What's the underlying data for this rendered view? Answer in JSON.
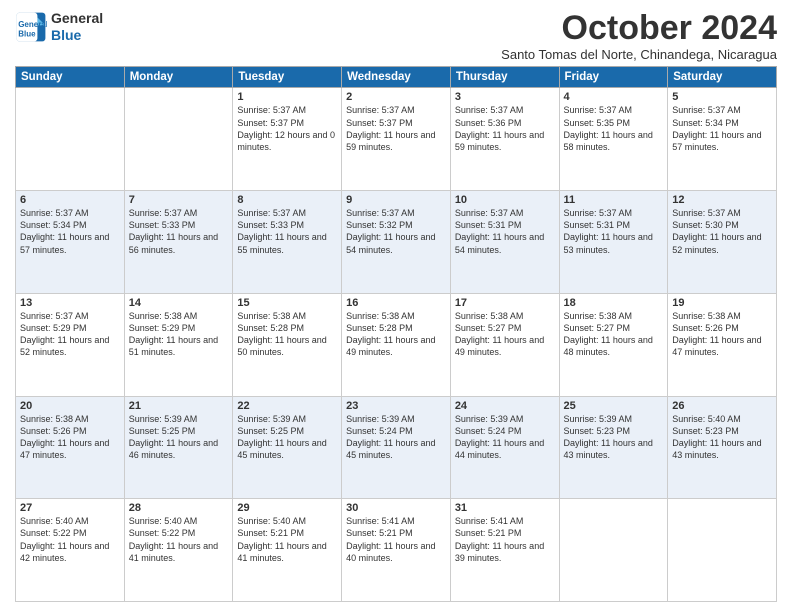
{
  "header": {
    "logo_line1": "General",
    "logo_line2": "Blue",
    "month_title": "October 2024",
    "subtitle": "Santo Tomas del Norte, Chinandega, Nicaragua"
  },
  "days_of_week": [
    "Sunday",
    "Monday",
    "Tuesday",
    "Wednesday",
    "Thursday",
    "Friday",
    "Saturday"
  ],
  "weeks": [
    [
      {
        "day": "",
        "info": ""
      },
      {
        "day": "",
        "info": ""
      },
      {
        "day": "1",
        "info": "Sunrise: 5:37 AM\nSunset: 5:37 PM\nDaylight: 12 hours and 0 minutes."
      },
      {
        "day": "2",
        "info": "Sunrise: 5:37 AM\nSunset: 5:37 PM\nDaylight: 11 hours and 59 minutes."
      },
      {
        "day": "3",
        "info": "Sunrise: 5:37 AM\nSunset: 5:36 PM\nDaylight: 11 hours and 59 minutes."
      },
      {
        "day": "4",
        "info": "Sunrise: 5:37 AM\nSunset: 5:35 PM\nDaylight: 11 hours and 58 minutes."
      },
      {
        "day": "5",
        "info": "Sunrise: 5:37 AM\nSunset: 5:34 PM\nDaylight: 11 hours and 57 minutes."
      }
    ],
    [
      {
        "day": "6",
        "info": "Sunrise: 5:37 AM\nSunset: 5:34 PM\nDaylight: 11 hours and 57 minutes."
      },
      {
        "day": "7",
        "info": "Sunrise: 5:37 AM\nSunset: 5:33 PM\nDaylight: 11 hours and 56 minutes."
      },
      {
        "day": "8",
        "info": "Sunrise: 5:37 AM\nSunset: 5:33 PM\nDaylight: 11 hours and 55 minutes."
      },
      {
        "day": "9",
        "info": "Sunrise: 5:37 AM\nSunset: 5:32 PM\nDaylight: 11 hours and 54 minutes."
      },
      {
        "day": "10",
        "info": "Sunrise: 5:37 AM\nSunset: 5:31 PM\nDaylight: 11 hours and 54 minutes."
      },
      {
        "day": "11",
        "info": "Sunrise: 5:37 AM\nSunset: 5:31 PM\nDaylight: 11 hours and 53 minutes."
      },
      {
        "day": "12",
        "info": "Sunrise: 5:37 AM\nSunset: 5:30 PM\nDaylight: 11 hours and 52 minutes."
      }
    ],
    [
      {
        "day": "13",
        "info": "Sunrise: 5:37 AM\nSunset: 5:29 PM\nDaylight: 11 hours and 52 minutes."
      },
      {
        "day": "14",
        "info": "Sunrise: 5:38 AM\nSunset: 5:29 PM\nDaylight: 11 hours and 51 minutes."
      },
      {
        "day": "15",
        "info": "Sunrise: 5:38 AM\nSunset: 5:28 PM\nDaylight: 11 hours and 50 minutes."
      },
      {
        "day": "16",
        "info": "Sunrise: 5:38 AM\nSunset: 5:28 PM\nDaylight: 11 hours and 49 minutes."
      },
      {
        "day": "17",
        "info": "Sunrise: 5:38 AM\nSunset: 5:27 PM\nDaylight: 11 hours and 49 minutes."
      },
      {
        "day": "18",
        "info": "Sunrise: 5:38 AM\nSunset: 5:27 PM\nDaylight: 11 hours and 48 minutes."
      },
      {
        "day": "19",
        "info": "Sunrise: 5:38 AM\nSunset: 5:26 PM\nDaylight: 11 hours and 47 minutes."
      }
    ],
    [
      {
        "day": "20",
        "info": "Sunrise: 5:38 AM\nSunset: 5:26 PM\nDaylight: 11 hours and 47 minutes."
      },
      {
        "day": "21",
        "info": "Sunrise: 5:39 AM\nSunset: 5:25 PM\nDaylight: 11 hours and 46 minutes."
      },
      {
        "day": "22",
        "info": "Sunrise: 5:39 AM\nSunset: 5:25 PM\nDaylight: 11 hours and 45 minutes."
      },
      {
        "day": "23",
        "info": "Sunrise: 5:39 AM\nSunset: 5:24 PM\nDaylight: 11 hours and 45 minutes."
      },
      {
        "day": "24",
        "info": "Sunrise: 5:39 AM\nSunset: 5:24 PM\nDaylight: 11 hours and 44 minutes."
      },
      {
        "day": "25",
        "info": "Sunrise: 5:39 AM\nSunset: 5:23 PM\nDaylight: 11 hours and 43 minutes."
      },
      {
        "day": "26",
        "info": "Sunrise: 5:40 AM\nSunset: 5:23 PM\nDaylight: 11 hours and 43 minutes."
      }
    ],
    [
      {
        "day": "27",
        "info": "Sunrise: 5:40 AM\nSunset: 5:22 PM\nDaylight: 11 hours and 42 minutes."
      },
      {
        "day": "28",
        "info": "Sunrise: 5:40 AM\nSunset: 5:22 PM\nDaylight: 11 hours and 41 minutes."
      },
      {
        "day": "29",
        "info": "Sunrise: 5:40 AM\nSunset: 5:21 PM\nDaylight: 11 hours and 41 minutes."
      },
      {
        "day": "30",
        "info": "Sunrise: 5:41 AM\nSunset: 5:21 PM\nDaylight: 11 hours and 40 minutes."
      },
      {
        "day": "31",
        "info": "Sunrise: 5:41 AM\nSunset: 5:21 PM\nDaylight: 11 hours and 39 minutes."
      },
      {
        "day": "",
        "info": ""
      },
      {
        "day": "",
        "info": ""
      }
    ]
  ]
}
